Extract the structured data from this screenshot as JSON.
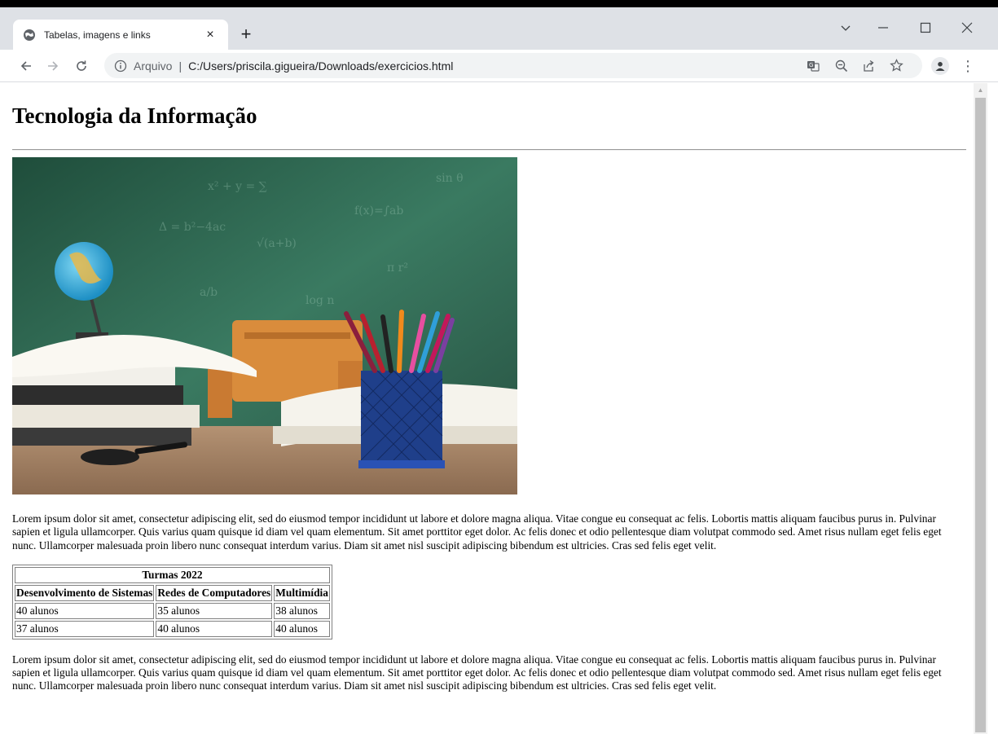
{
  "browser": {
    "tab": {
      "title": "Tabelas, imagens e links",
      "close_glyph": "×",
      "favicon": "globe-icon"
    },
    "new_tab_glyph": "+",
    "window_controls": {
      "tab_search_glyph": "﹀",
      "minimize_glyph": "—",
      "maximize_glyph": "☐",
      "close_glyph": "✕"
    },
    "nav": {
      "back_glyph": "←",
      "forward_glyph": "→",
      "reload_glyph": "C"
    },
    "omnibox": {
      "scheme_label": "Arquivo",
      "separator": "|",
      "url": "C:/Users/priscila.gigueira/Downloads/exercicios.html"
    },
    "omnibox_actions": [
      "translate-icon",
      "zoom-out-icon",
      "share-icon",
      "bookmark-star-icon"
    ],
    "menu_glyph": "⋮"
  },
  "page": {
    "heading": "Tecnologia da Informação",
    "hero_image": {
      "description_icon": "classroom-photo",
      "colors": {
        "chalkboard": "#2f5e4a",
        "desk": "#a98664",
        "cup": "#1f3f8a"
      }
    },
    "paragraph_1": "Lorem ipsum dolor sit amet, consectetur adipiscing elit, sed do eiusmod tempor incididunt ut labore et dolore magna aliqua. Vitae congue eu consequat ac felis. Lobortis mattis aliquam faucibus purus in. Pulvinar sapien et ligula ullamcorper. Quis varius quam quisque id diam vel quam elementum. Sit amet porttitor eget dolor. Ac felis donec et odio pellentesque diam volutpat commodo sed. Amet risus nullam eget felis eget nunc. Ullamcorper malesuada proin libero nunc consequat interdum varius. Diam sit amet nisl suscipit adipiscing bibendum est ultricies. Cras sed felis eget velit.",
    "table": {
      "caption": "Turmas 2022",
      "headers": [
        "Desenvolvimento de Sistemas",
        "Redes de Computadores",
        "Multimídia"
      ],
      "rows": [
        [
          "40 alunos",
          "35 alunos",
          "38 alunos"
        ],
        [
          "37 alunos",
          "40 alunos",
          "40 alunos"
        ]
      ]
    },
    "paragraph_2": "Lorem ipsum dolor sit amet, consectetur adipiscing elit, sed do eiusmod tempor incididunt ut labore et dolore magna aliqua. Vitae congue eu consequat ac felis. Lobortis mattis aliquam faucibus purus in. Pulvinar sapien et ligula ullamcorper. Quis varius quam quisque id diam vel quam elementum. Sit amet porttitor eget dolor. Ac felis donec et odio pellentesque diam volutpat commodo sed. Amet risus nullam eget felis eget nunc. Ullamcorper malesuada proin libero nunc consequat interdum varius. Diam sit amet nisl suscipit adipiscing bibendum est ultricies. Cras sed felis eget velit."
  }
}
